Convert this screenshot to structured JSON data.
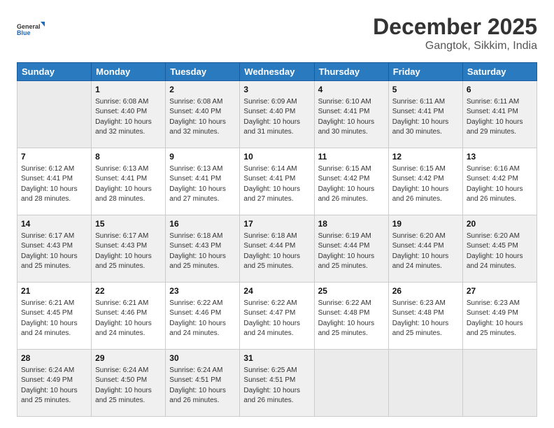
{
  "header": {
    "logo_general": "General",
    "logo_blue": "Blue",
    "month_year": "December 2025",
    "location": "Gangtok, Sikkim, India"
  },
  "days_of_week": [
    "Sunday",
    "Monday",
    "Tuesday",
    "Wednesday",
    "Thursday",
    "Friday",
    "Saturday"
  ],
  "weeks": [
    [
      {
        "num": "",
        "info": ""
      },
      {
        "num": "1",
        "info": "Sunrise: 6:08 AM\nSunset: 4:40 PM\nDaylight: 10 hours\nand 32 minutes."
      },
      {
        "num": "2",
        "info": "Sunrise: 6:08 AM\nSunset: 4:40 PM\nDaylight: 10 hours\nand 32 minutes."
      },
      {
        "num": "3",
        "info": "Sunrise: 6:09 AM\nSunset: 4:40 PM\nDaylight: 10 hours\nand 31 minutes."
      },
      {
        "num": "4",
        "info": "Sunrise: 6:10 AM\nSunset: 4:41 PM\nDaylight: 10 hours\nand 30 minutes."
      },
      {
        "num": "5",
        "info": "Sunrise: 6:11 AM\nSunset: 4:41 PM\nDaylight: 10 hours\nand 30 minutes."
      },
      {
        "num": "6",
        "info": "Sunrise: 6:11 AM\nSunset: 4:41 PM\nDaylight: 10 hours\nand 29 minutes."
      }
    ],
    [
      {
        "num": "7",
        "info": "Sunrise: 6:12 AM\nSunset: 4:41 PM\nDaylight: 10 hours\nand 28 minutes."
      },
      {
        "num": "8",
        "info": "Sunrise: 6:13 AM\nSunset: 4:41 PM\nDaylight: 10 hours\nand 28 minutes."
      },
      {
        "num": "9",
        "info": "Sunrise: 6:13 AM\nSunset: 4:41 PM\nDaylight: 10 hours\nand 27 minutes."
      },
      {
        "num": "10",
        "info": "Sunrise: 6:14 AM\nSunset: 4:41 PM\nDaylight: 10 hours\nand 27 minutes."
      },
      {
        "num": "11",
        "info": "Sunrise: 6:15 AM\nSunset: 4:42 PM\nDaylight: 10 hours\nand 26 minutes."
      },
      {
        "num": "12",
        "info": "Sunrise: 6:15 AM\nSunset: 4:42 PM\nDaylight: 10 hours\nand 26 minutes."
      },
      {
        "num": "13",
        "info": "Sunrise: 6:16 AM\nSunset: 4:42 PM\nDaylight: 10 hours\nand 26 minutes."
      }
    ],
    [
      {
        "num": "14",
        "info": "Sunrise: 6:17 AM\nSunset: 4:43 PM\nDaylight: 10 hours\nand 25 minutes."
      },
      {
        "num": "15",
        "info": "Sunrise: 6:17 AM\nSunset: 4:43 PM\nDaylight: 10 hours\nand 25 minutes."
      },
      {
        "num": "16",
        "info": "Sunrise: 6:18 AM\nSunset: 4:43 PM\nDaylight: 10 hours\nand 25 minutes."
      },
      {
        "num": "17",
        "info": "Sunrise: 6:18 AM\nSunset: 4:44 PM\nDaylight: 10 hours\nand 25 minutes."
      },
      {
        "num": "18",
        "info": "Sunrise: 6:19 AM\nSunset: 4:44 PM\nDaylight: 10 hours\nand 25 minutes."
      },
      {
        "num": "19",
        "info": "Sunrise: 6:20 AM\nSunset: 4:44 PM\nDaylight: 10 hours\nand 24 minutes."
      },
      {
        "num": "20",
        "info": "Sunrise: 6:20 AM\nSunset: 4:45 PM\nDaylight: 10 hours\nand 24 minutes."
      }
    ],
    [
      {
        "num": "21",
        "info": "Sunrise: 6:21 AM\nSunset: 4:45 PM\nDaylight: 10 hours\nand 24 minutes."
      },
      {
        "num": "22",
        "info": "Sunrise: 6:21 AM\nSunset: 4:46 PM\nDaylight: 10 hours\nand 24 minutes."
      },
      {
        "num": "23",
        "info": "Sunrise: 6:22 AM\nSunset: 4:46 PM\nDaylight: 10 hours\nand 24 minutes."
      },
      {
        "num": "24",
        "info": "Sunrise: 6:22 AM\nSunset: 4:47 PM\nDaylight: 10 hours\nand 24 minutes."
      },
      {
        "num": "25",
        "info": "Sunrise: 6:22 AM\nSunset: 4:48 PM\nDaylight: 10 hours\nand 25 minutes."
      },
      {
        "num": "26",
        "info": "Sunrise: 6:23 AM\nSunset: 4:48 PM\nDaylight: 10 hours\nand 25 minutes."
      },
      {
        "num": "27",
        "info": "Sunrise: 6:23 AM\nSunset: 4:49 PM\nDaylight: 10 hours\nand 25 minutes."
      }
    ],
    [
      {
        "num": "28",
        "info": "Sunrise: 6:24 AM\nSunset: 4:49 PM\nDaylight: 10 hours\nand 25 minutes."
      },
      {
        "num": "29",
        "info": "Sunrise: 6:24 AM\nSunset: 4:50 PM\nDaylight: 10 hours\nand 25 minutes."
      },
      {
        "num": "30",
        "info": "Sunrise: 6:24 AM\nSunset: 4:51 PM\nDaylight: 10 hours\nand 26 minutes."
      },
      {
        "num": "31",
        "info": "Sunrise: 6:25 AM\nSunset: 4:51 PM\nDaylight: 10 hours\nand 26 minutes."
      },
      {
        "num": "",
        "info": ""
      },
      {
        "num": "",
        "info": ""
      },
      {
        "num": "",
        "info": ""
      }
    ]
  ]
}
